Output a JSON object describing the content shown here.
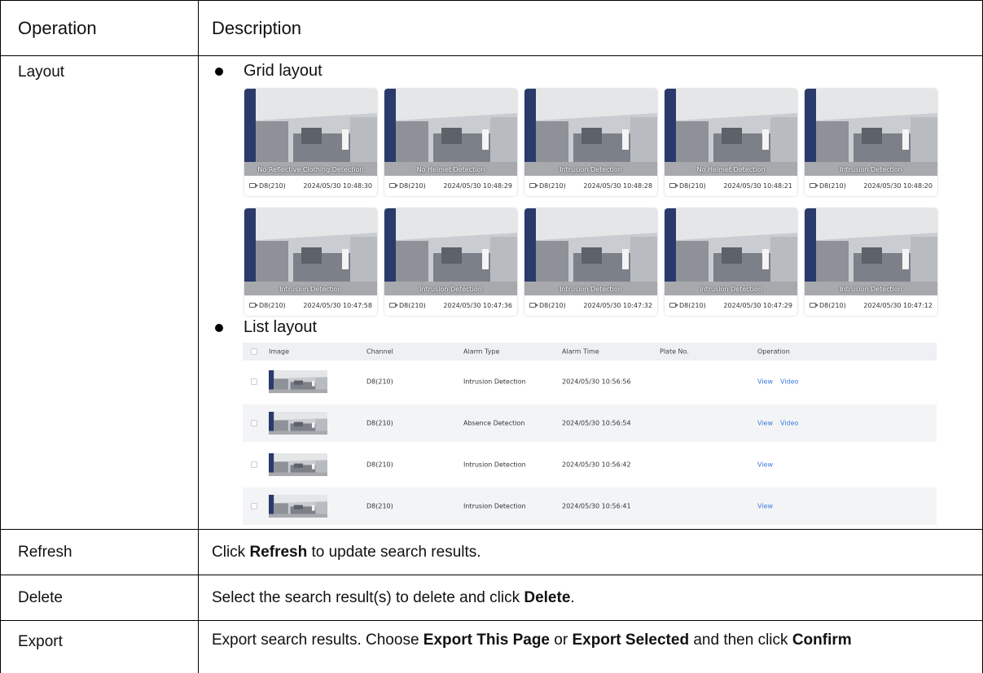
{
  "table": {
    "header": {
      "operation": "Operation",
      "description": "Description"
    },
    "rows": [
      {
        "operation": "Layout",
        "grid_bullet": "Grid layout",
        "list_bullet": "List layout"
      },
      {
        "operation": "Refresh",
        "desc_parts": [
          "Click ",
          "Refresh",
          " to update search results."
        ]
      },
      {
        "operation": "Delete",
        "desc_parts": [
          "Select the search result(s) to delete and click ",
          "Delete",
          "."
        ]
      },
      {
        "operation": "Export",
        "desc_parts": [
          "Export search results. Choose ",
          "Export This Page",
          " or ",
          "Export Selected",
          " and then click ",
          "Confirm"
        ]
      }
    ]
  },
  "grid_cards": [
    {
      "type": "No Reflective Clothing Detection",
      "channel": "D8(210)",
      "time": "2024/05/30 10:48:30"
    },
    {
      "type": "No Helmet Detection",
      "channel": "D8(210)",
      "time": "2024/05/30 10:48:29"
    },
    {
      "type": "Intrusion Detection",
      "channel": "D8(210)",
      "time": "2024/05/30 10:48:28"
    },
    {
      "type": "No Helmet Detection",
      "channel": "D8(210)",
      "time": "2024/05/30 10:48:21"
    },
    {
      "type": "Intrusion Detection",
      "channel": "D8(210)",
      "time": "2024/05/30 10:48:20"
    },
    {
      "type": "Intrusion Detection",
      "channel": "D8(210)",
      "time": "2024/05/30 10:47:58"
    },
    {
      "type": "Intrusion Detection",
      "channel": "D8(210)",
      "time": "2024/05/30 10:47:36"
    },
    {
      "type": "Intrusion Detection",
      "channel": "D8(210)",
      "time": "2024/05/30 10:47:32"
    },
    {
      "type": "Intrusion Detection",
      "channel": "D8(210)",
      "time": "2024/05/30 10:47:29"
    },
    {
      "type": "Intrusion Detection",
      "channel": "D8(210)",
      "time": "2024/05/30 10:47:12"
    }
  ],
  "list": {
    "columns": [
      "Image",
      "Channel",
      "Alarm Type",
      "Alarm Time",
      "Plate No.",
      "Operation"
    ],
    "rows": [
      {
        "channel": "D8(210)",
        "alarm_type": "Intrusion Detection",
        "alarm_time": "2024/05/30 10:56:56",
        "plate": "",
        "ops": [
          "View",
          "Video"
        ]
      },
      {
        "channel": "D8(210)",
        "alarm_type": "Absence Detection",
        "alarm_time": "2024/05/30 10:56:54",
        "plate": "",
        "ops": [
          "View",
          "Video"
        ]
      },
      {
        "channel": "D8(210)",
        "alarm_type": "Intrusion Detection",
        "alarm_time": "2024/05/30 10:56:42",
        "plate": "",
        "ops": [
          "View"
        ]
      },
      {
        "channel": "D8(210)",
        "alarm_type": "Intrusion Detection",
        "alarm_time": "2024/05/30 10:56:41",
        "plate": "",
        "ops": [
          "View"
        ]
      }
    ]
  },
  "colors": {
    "link": "#3a7bdb",
    "list_header_bg": "#eef0f3",
    "row_alt_bg": "#f3f4f6"
  }
}
